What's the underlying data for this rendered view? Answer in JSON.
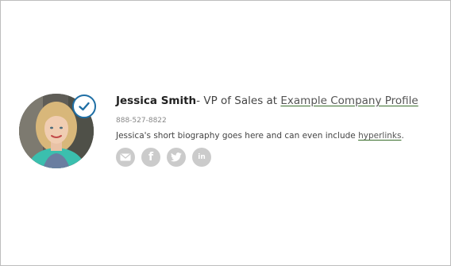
{
  "profile": {
    "name": "Jessica Smith",
    "separator": "- VP of Sales at ",
    "company_link": "Example Company Profile",
    "phone": "888-527-8822",
    "bio_text": "Jessica's short biography goes here and can even include ",
    "bio_link": "hyperlinks",
    "bio_end": "."
  },
  "socials": [
    {
      "name": "email-icon"
    },
    {
      "name": "facebook-icon",
      "glyph": "f"
    },
    {
      "name": "twitter-icon"
    },
    {
      "name": "linkedin-icon",
      "glyph": "in"
    }
  ],
  "colors": {
    "accent": "#1f6fa5",
    "social_bg": "#cbcbcb",
    "link_underline": "#3a6e2c"
  }
}
